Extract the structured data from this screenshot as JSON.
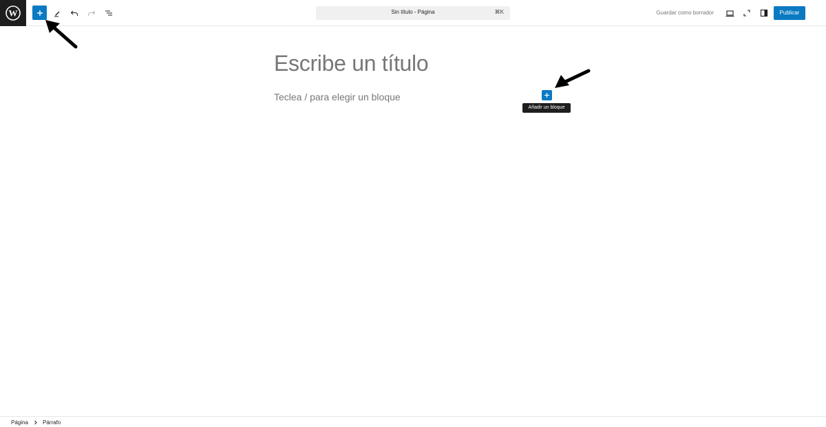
{
  "toolbar": {
    "document_title": "Sin título - Página",
    "shortcut": "⌘K",
    "save_draft_label": "Guardar como borrador",
    "publish_label": "Publicar",
    "accent_color": "#0a7ac3"
  },
  "icons": {
    "logo": "wordpress-icon",
    "inserter": "plus-icon",
    "tools": "pencil-icon",
    "undo": "undo-icon",
    "redo": "redo-icon",
    "outline": "list-view-icon",
    "preview": "desktop-icon",
    "external": "external-link-icon",
    "settings": "sidebar-icon"
  },
  "editor": {
    "title_placeholder": "Escribe un título",
    "block_placeholder": "Teclea / para elegir un bloque",
    "add_block_tooltip": "Añadir un bloque"
  },
  "breadcrumb": {
    "items": [
      "Página",
      "Párrafo"
    ]
  }
}
